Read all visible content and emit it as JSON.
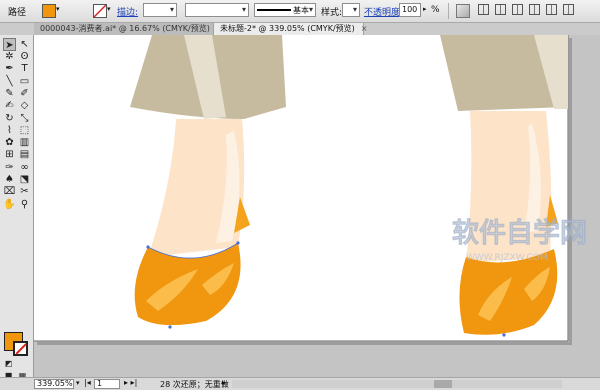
{
  "control_bar": {
    "object_type": "路径",
    "fill_color": "#f0960f",
    "stroke_label": "描边:",
    "stroke_weight": "",
    "brush_label": "基本",
    "style_label": "样式:",
    "opacity_label": "不透明度:",
    "opacity_value": "100",
    "opacity_unit": "%"
  },
  "tabs": [
    {
      "label": "0000043-消费者.ai* @ 16.67% (CMYK/预览)",
      "close": "×"
    },
    {
      "label": "未标题-2* @ 339.05% (CMYK/预览)",
      "close": "×"
    }
  ],
  "status_bar": {
    "zoom": "339.05%",
    "page": "1",
    "message": "28 次还原；无重做"
  },
  "watermark": {
    "text": "软件自学网",
    "url": "WWW.RJZXW.COM"
  },
  "colors": {
    "shoe": "#f0960f",
    "shoe_light": "#fbbc4a",
    "skin": "#fde3c8",
    "trousers": "#c7bb9f"
  },
  "tools": [
    "selection-tool",
    "direct-selection-tool",
    "magic-wand-tool",
    "lasso-tool",
    "pen-tool",
    "type-tool",
    "line-tool",
    "rectangle-tool",
    "paintbrush-tool",
    "pencil-tool",
    "blob-brush-tool",
    "eraser-tool",
    "rotate-tool",
    "scale-tool",
    "warp-tool",
    "free-transform-tool",
    "symbol-sprayer-tool",
    "column-graph-tool",
    "mesh-tool",
    "gradient-tool",
    "eyedropper-tool",
    "blend-tool",
    "live-paint-tool",
    "live-paint-selection-tool",
    "slice-tool",
    "scissors-tool",
    "hand-tool",
    "zoom-tool"
  ]
}
